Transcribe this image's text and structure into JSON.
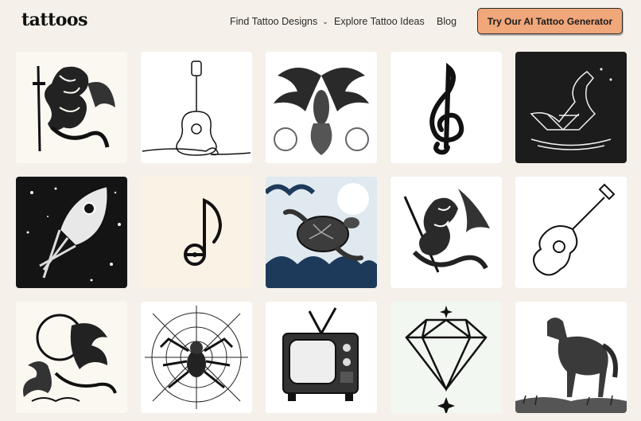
{
  "brand": {
    "logo": "tattoos"
  },
  "nav": {
    "find": "Find Tattoo Designs",
    "explore": "Explore Tattoo Ideas",
    "blog": "Blog",
    "cta": "Try Our AI Tattoo Generator"
  },
  "gallery": {
    "tiles": [
      {
        "subject": "dragon-with-sword",
        "bg": "#fbf8f2"
      },
      {
        "subject": "guitar-line-art",
        "bg": "#ffffff"
      },
      {
        "subject": "phoenix",
        "bg": "#ffffff"
      },
      {
        "subject": "treble-clef",
        "bg": "#ffffff"
      },
      {
        "subject": "geometric-swan",
        "bg": "#1c1c1c"
      },
      {
        "subject": "rocket-in-space",
        "bg": "#141414"
      },
      {
        "subject": "music-note",
        "bg": "#fbf2e6"
      },
      {
        "subject": "sea-turtle-waves",
        "bg": "#dfe9ef"
      },
      {
        "subject": "dragon-with-sword",
        "bg": "#ffffff"
      },
      {
        "subject": "guitar-outline",
        "bg": "#ffffff"
      },
      {
        "subject": "phoenix-moon",
        "bg": "#fbf8f2"
      },
      {
        "subject": "spider-web",
        "bg": "#ffffff"
      },
      {
        "subject": "retro-television",
        "bg": "#ffffff"
      },
      {
        "subject": "diamond",
        "bg": "#f3f7f1"
      },
      {
        "subject": "horse",
        "bg": "#ffffff"
      }
    ]
  }
}
